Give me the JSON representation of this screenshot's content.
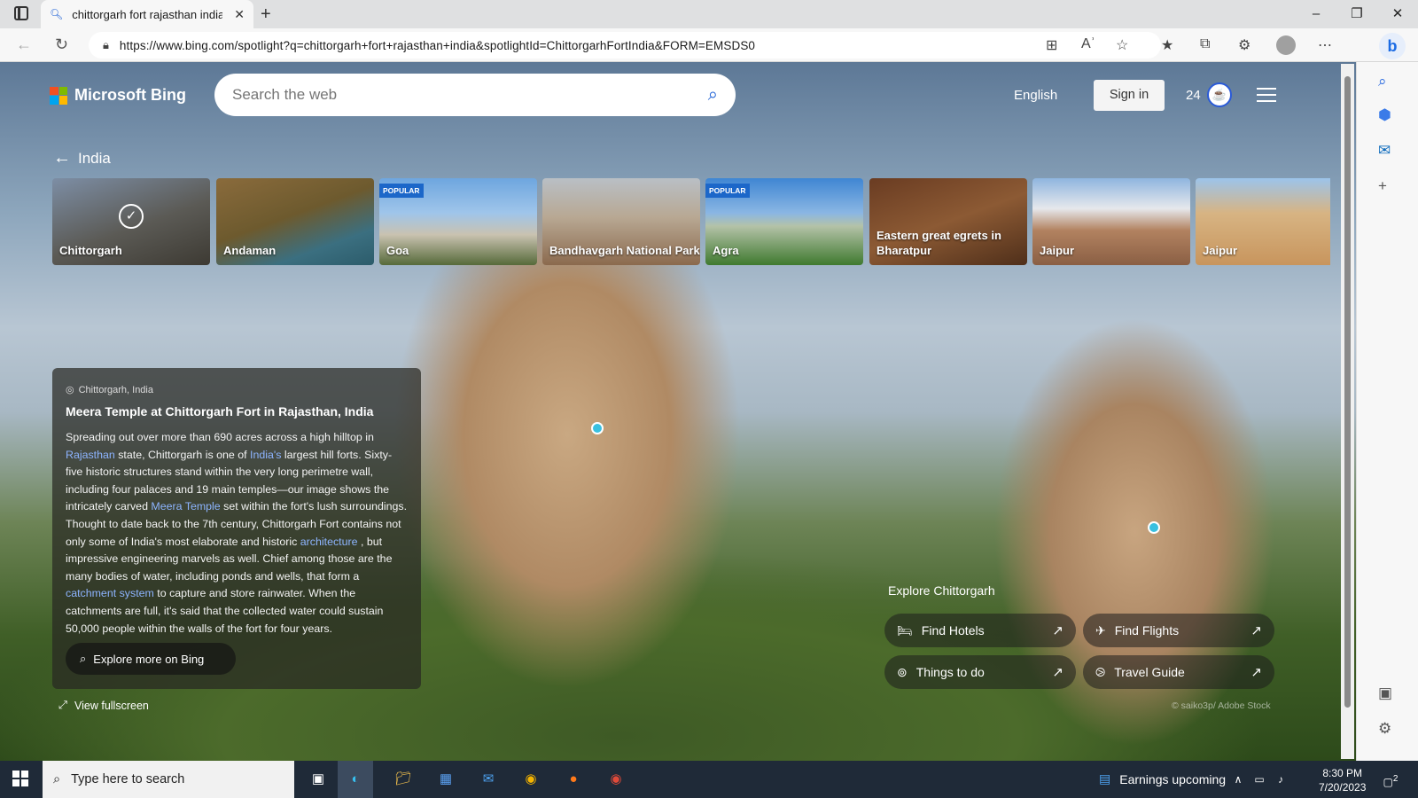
{
  "browser": {
    "tab_title": "chittorgarh fort rajasthan india -",
    "url": "https://www.bing.com/spotlight?q=chittorgarh+fort+rajasthan+india&spotlightId=ChittorgarhFortIndia&FORM=EMSDS0"
  },
  "header": {
    "brand": "Microsoft Bing",
    "search_placeholder": "Search the web",
    "language": "English",
    "sign_in": "Sign in",
    "points": "24"
  },
  "nav": {
    "back_label": "India"
  },
  "cards": [
    {
      "label": "Chittorgarh",
      "popular": "",
      "selected": true
    },
    {
      "label": "Andaman",
      "popular": ""
    },
    {
      "label": "Goa",
      "popular": "POPULAR"
    },
    {
      "label": "Bandhavgarh National Park",
      "popular": ""
    },
    {
      "label": "Agra",
      "popular": "POPULAR"
    },
    {
      "label": "Eastern great egrets in Bharatpur",
      "popular": ""
    },
    {
      "label": "Jaipur",
      "popular": ""
    },
    {
      "label": "Jaipur",
      "popular": ""
    }
  ],
  "info": {
    "location": "Chittorgarh, India",
    "title": "Meera Temple at Chittorgarh Fort in Rajasthan, India",
    "p1": "Spreading out over more than 690 acres across a high hilltop in",
    "link_rajasthan": "Rajasthan",
    "p2": " state, Chittorgarh is one of ",
    "link_india": "India's",
    "p3": " largest hill forts. Sixty-five historic structures stand within the very long perimetre wall, including four palaces and 19 main temples—our image shows the intricately carved ",
    "link_meera": "Meera Temple",
    "p4": " set within the fort's lush surroundings. Thought to date back to the 7th century, Chittorgarh Fort contains not only some of India's most elaborate and historic ",
    "link_arch": "architecture",
    "p5": " , but impressive engineering marvels as well. Chief among those are the many bodies of water, including ponds and wells, that form a ",
    "link_catch": "catchment system",
    "p6": " to capture and store rainwater. When the catchments are full, it's said that the collected water could sustain 50,000 people within the walls of the fort for four years.",
    "explore_button": "Explore more on Bing"
  },
  "fullscreen": "View fullscreen",
  "explore": {
    "heading": "Explore Chittorgarh",
    "hotels": "Find Hotels",
    "flights": "Find Flights",
    "things": "Things to do",
    "guide": "Travel Guide"
  },
  "credit": "© saiko3p/ Adobe Stock",
  "taskbar": {
    "search": "Type here to search",
    "news": "Earnings upcoming",
    "time": "8:30 PM",
    "date": "7/20/2023",
    "notifications": "2"
  },
  "colors": {
    "bing_blue": "#1b5fd6",
    "link": "#8db4ff",
    "popular_badge": "#1c67c9"
  }
}
